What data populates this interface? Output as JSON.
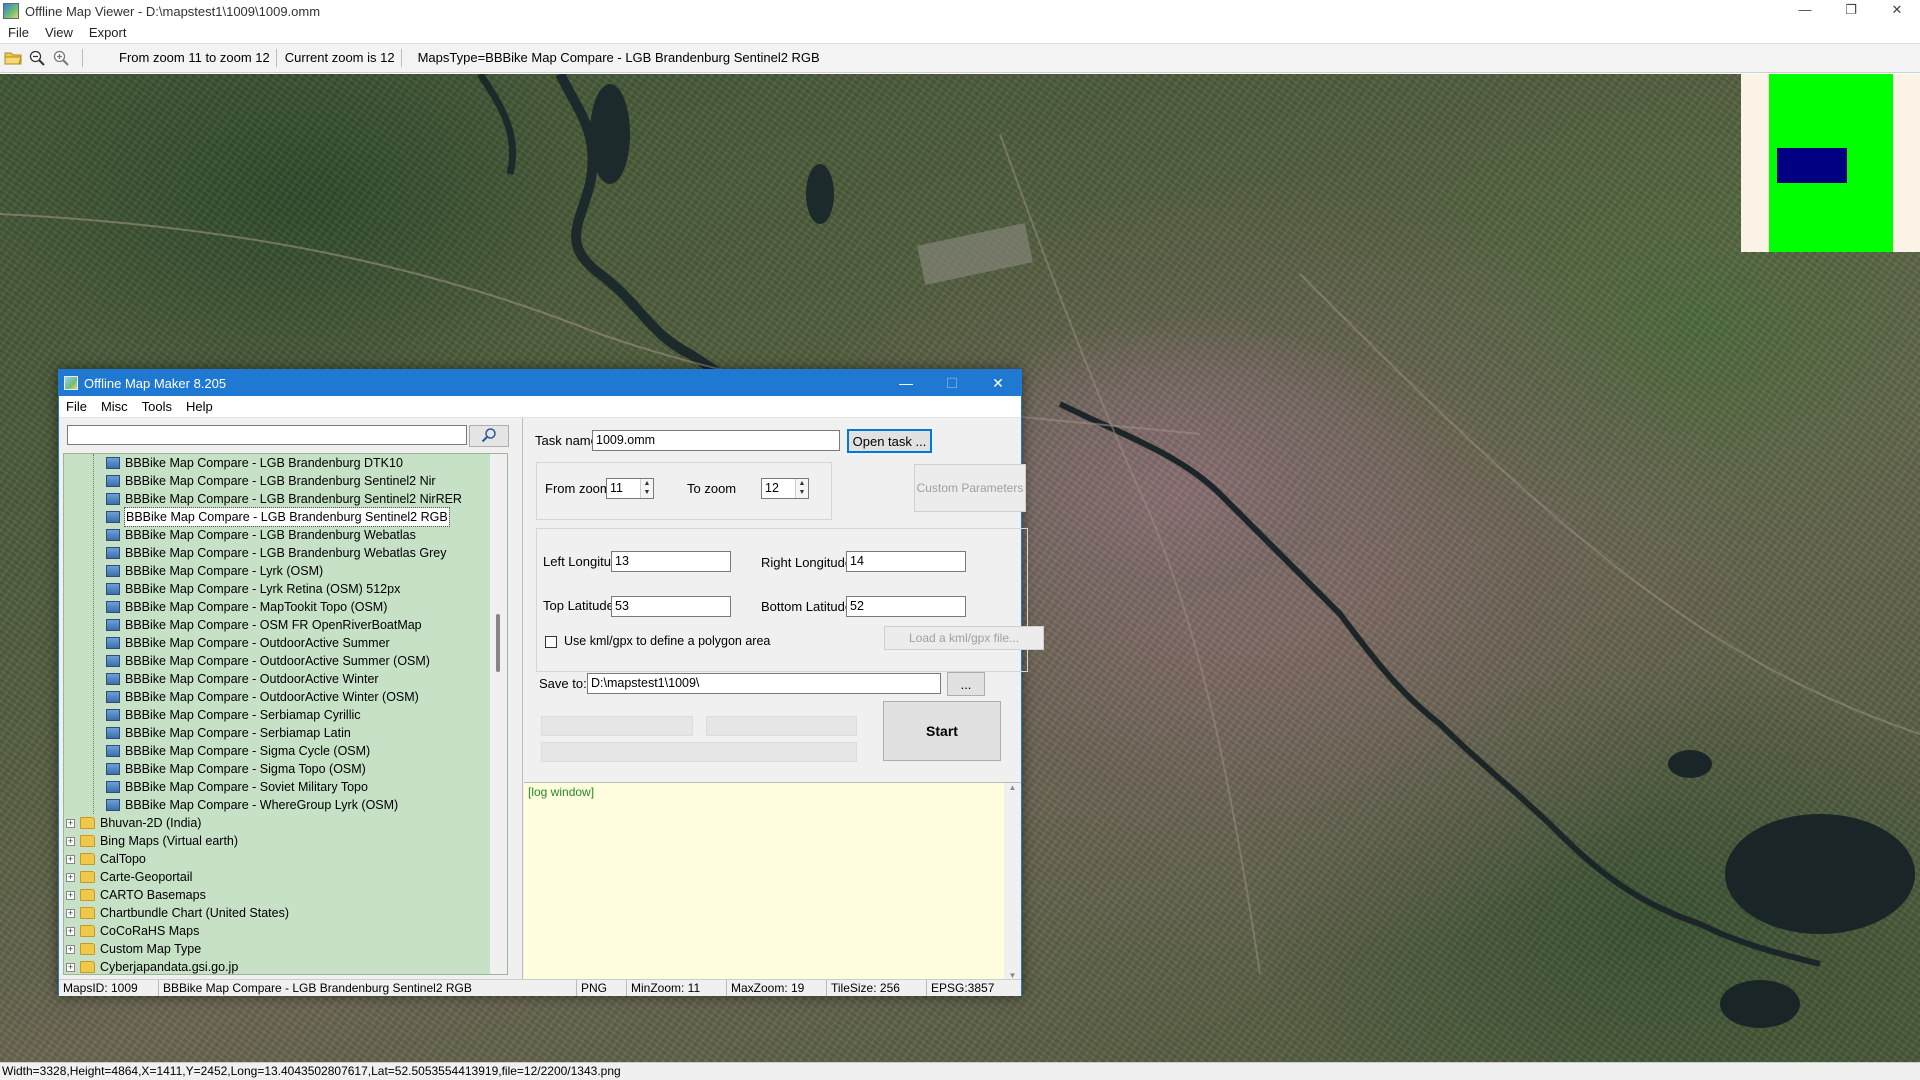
{
  "window": {
    "title": "Offline Map Viewer - D:\\mapstest1\\1009\\1009.omm",
    "buttons": {
      "minimize": "—",
      "maximize": "❐",
      "close": "✕"
    }
  },
  "menu": [
    "File",
    "View",
    "Export"
  ],
  "toolbar": {
    "zoom_range": "From zoom 11 to zoom 12",
    "current_zoom": "Current zoom is 12",
    "maps_type": "MapsType=BBBike Map Compare - LGB Brandenburg Sentinel2 RGB"
  },
  "statusbar": "Width=3328,Height=4864,X=1411,Y=2452,Long=13.4043502807617,Lat=52.5053554413919,file=12/2200/1343.png",
  "overview_colors": {
    "background": "#fbf4e6",
    "frame": "#00ff00",
    "viewport": "#000080"
  },
  "dialog": {
    "title": "Offline Map Maker 8.205",
    "buttons": {
      "minimize": "—",
      "maximize": "☐",
      "close": "✕"
    },
    "menu": [
      "File",
      "Misc",
      "Tools",
      "Help"
    ],
    "search": {
      "value": ""
    },
    "tree": {
      "children": [
        "BBBike Map Compare - LGB Brandenburg DTK10",
        "BBBike Map Compare - LGB Brandenburg Sentinel2 Nir",
        "BBBike Map Compare - LGB Brandenburg Sentinel2 NirRER",
        "BBBike Map Compare - LGB Brandenburg Sentinel2 RGB",
        "BBBike Map Compare - LGB Brandenburg Webatlas",
        "BBBike Map Compare - LGB Brandenburg Webatlas Grey",
        "BBBike Map Compare - Lyrk (OSM)",
        "BBBike Map Compare - Lyrk Retina (OSM) 512px",
        "BBBike Map Compare - MapTookit Topo (OSM)",
        "BBBike Map Compare - OSM FR OpenRiverBoatMap",
        "BBBike Map Compare - OutdoorActive Summer",
        "BBBike Map Compare - OutdoorActive Summer (OSM)",
        "BBBike Map Compare - OutdoorActive Winter",
        "BBBike Map Compare - OutdoorActive Winter (OSM)",
        "BBBike Map Compare - Serbiamap Cyrillic",
        "BBBike Map Compare - Serbiamap Latin",
        "BBBike Map Compare - Sigma Cycle (OSM)",
        "BBBike Map Compare - Sigma Topo (OSM)",
        "BBBike Map Compare - Soviet Military Topo",
        "BBBike Map Compare - WhereGroup Lyrk (OSM)"
      ],
      "selected_index": 3,
      "parents": [
        "Bhuvan-2D (India)",
        "Bing Maps (Virtual earth)",
        "CalTopo",
        "Carte-Geoportail",
        "CARTO Basemaps",
        "Chartbundle Chart (United States)",
        "CoCoRaHS Maps",
        "Custom Map Type",
        "Cyberjapandata.gsi.go.jp"
      ]
    },
    "status": {
      "maps_id": "MapsID: 1009",
      "map_name": "BBBike Map Compare - LGB Brandenburg Sentinel2 RGB",
      "format": "PNG",
      "min_zoom": "MinZoom: 11",
      "max_zoom": "MaxZoom: 19",
      "tile_size": "TileSize: 256",
      "epsg": "EPSG:3857"
    },
    "task": {
      "label": "Task name",
      "value": "1009.omm",
      "open_button": "Open task ..."
    },
    "zoom": {
      "from_label": "From zoom",
      "from_value": "11",
      "to_label": "To zoom",
      "to_value": "12",
      "custom_button": "Custom Parameters"
    },
    "coords": {
      "left_lon_label": "Left Longitude",
      "left_lon": "13",
      "right_lon_label": "Right Longitude",
      "right_lon": "14",
      "top_lat_label": "Top Latitude",
      "top_lat": "53",
      "bottom_lat_label": "Bottom Latitude",
      "bottom_lat": "52",
      "kml_checkbox_label": "Use kml/gpx to define a polygon area",
      "kml_button": "Load a kml/gpx file..."
    },
    "save": {
      "label": "Save to:",
      "value": "D:\\mapstest1\\1009\\",
      "browse_button": "..."
    },
    "start_button": "Start",
    "log": {
      "text": "[log window]"
    }
  }
}
